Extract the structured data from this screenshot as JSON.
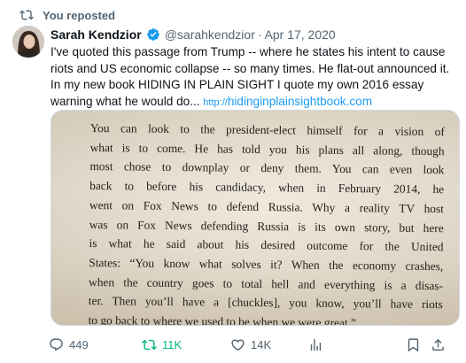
{
  "repost": {
    "label": "You reposted"
  },
  "author": {
    "name": "Sarah Kendzior",
    "handle": "@sarahkendzior",
    "separator": "·",
    "date": "Apr 17, 2020"
  },
  "tweet": {
    "text": "I've quoted this passage from Trump -- where he states his intent to cause riots and US economic collapse -- so many times. He flat-out announced it. In my new book HIDING IN PLAIN SIGHT I quote my own 2016 essay warning what he would do... ",
    "link_proto": "http://",
    "link_domain": "hidinginplainsightbook.com"
  },
  "book_page": {
    "lines": [
      "You can look to the president-elect himself for a vision of",
      "what is to come. He has told you his plans all along, though",
      "most chose to downplay or deny them. You can even look",
      "back to before his candidacy, when in February 2014, he",
      "went on Fox News to defend Russia. Why a reality TV host",
      "was on Fox News defending Russia is its own story, but here",
      "is what he said about his desired outcome for the United",
      "States: “You know what solves it? When the economy crashes,",
      "when the country goes to total hell and everything is a disas-",
      "ter. Then you’ll have a [chuckles], you know, you’ll have riots",
      "to go back to where we used to be when we were great.”"
    ]
  },
  "actions": {
    "replies": "449",
    "reposts": "11K",
    "likes": "14K"
  },
  "icons": {
    "repost": "repost-icon",
    "verified": "verified-badge-icon",
    "reply": "reply-icon",
    "like": "heart-icon",
    "views": "views-icon",
    "bookmark": "bookmark-icon",
    "share": "share-icon"
  },
  "colors": {
    "text": "#0f1419",
    "muted": "#536471",
    "link": "#1d9bf0",
    "verified": "#1d9bf0",
    "repost_active": "#00ba7c"
  }
}
